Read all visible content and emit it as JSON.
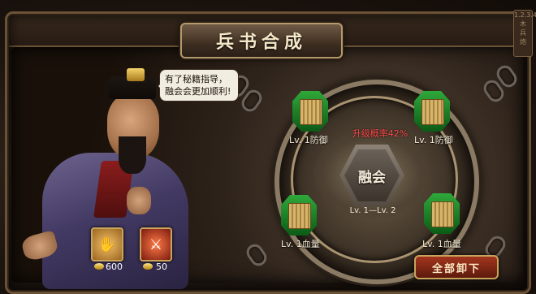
{
  "panel": {
    "title": "兵书合成"
  },
  "side_deco": {
    "text": [
      "1.2.3.4.5.6",
      "木",
      "兵",
      "炮"
    ]
  },
  "advisor": {
    "speech": "有了秘籍指导，融会会更加顺利!"
  },
  "skills": [
    {
      "icon": "hand-skill-icon",
      "cost": "600"
    },
    {
      "icon": "warrior-skill-icon",
      "cost": "50"
    }
  ],
  "fusion": {
    "button_label": "融会",
    "level_range": "Lv. 1—Lv. 2",
    "success_rate": "升级概率42%"
  },
  "slots": [
    {
      "label": "Lv. 1防御"
    },
    {
      "label": "Lv. 1防御"
    },
    {
      "label": "Lv. 1血量"
    },
    {
      "label": "Lv. 1血量"
    }
  ],
  "unequip_all": {
    "label": "全部卸下"
  },
  "colors": {
    "rate": "#ff4a4a",
    "slot_glow": "#2fa83a",
    "button": "#a2351e"
  }
}
